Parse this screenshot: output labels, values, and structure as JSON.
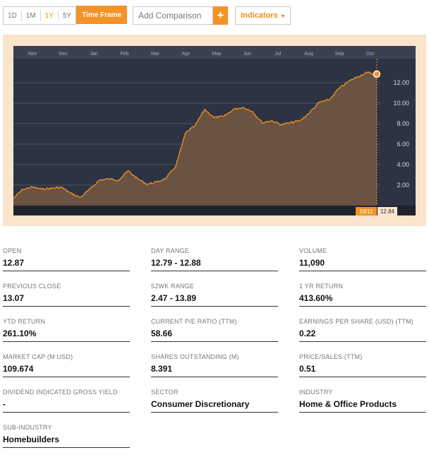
{
  "toolbar": {
    "ranges": [
      "1D",
      "1M",
      "1Y",
      "5Y"
    ],
    "active_range": "1Y",
    "time_frame_label": "Time Frame",
    "compare_placeholder": "Add Comparison",
    "plus_label": "+",
    "indicators_label": "Indicators"
  },
  "chart_data": {
    "type": "area",
    "x_tick_labels": [
      "Nov",
      "Dec",
      "Jan",
      "Feb",
      "Mar",
      "Apr",
      "May",
      "Jun",
      "Jul",
      "Aug",
      "Sep",
      "Oct"
    ],
    "y_ticks": [
      "2.00",
      "4.00",
      "6.00",
      "8.00",
      "10.00",
      "12.00"
    ],
    "ylim": [
      0,
      13.8
    ],
    "x": [
      "10/11",
      "10/21",
      "10/31",
      "11/10",
      "11/20",
      "11/30",
      "12/10",
      "12/20",
      "12/30",
      "01/09",
      "01/19",
      "01/29",
      "02/08",
      "02/18",
      "02/28",
      "03/10",
      "03/20",
      "03/30",
      "04/09",
      "04/19",
      "04/29",
      "05/09",
      "05/19",
      "05/29",
      "06/08",
      "06/18",
      "06/28",
      "07/08",
      "07/18",
      "07/28",
      "08/07",
      "08/17",
      "08/27",
      "09/06",
      "09/16",
      "09/26",
      "10/01",
      "10/06",
      "10/11"
    ],
    "values": [
      0.7,
      1.6,
      1.8,
      1.6,
      1.7,
      1.8,
      1.2,
      0.8,
      1.6,
      2.5,
      2.6,
      2.5,
      3.4,
      2.6,
      2.1,
      2.3,
      2.7,
      3.9,
      7.1,
      7.8,
      9.4,
      8.6,
      8.7,
      9.4,
      9.6,
      9.2,
      8.1,
      8.3,
      7.9,
      8.1,
      8.3,
      9.1,
      10.1,
      10.3,
      11.4,
      12.1,
      12.6,
      13.0,
      12.84
    ],
    "colors": {
      "background": "#2c3342",
      "line": "#f39325",
      "fill": "#6e5542"
    },
    "cursor": {
      "date_label": "10/11",
      "value_label": "12.84"
    }
  },
  "stats": [
    {
      "label": "OPEN",
      "value": "12.87"
    },
    {
      "label": "DAY RANGE",
      "value": "12.79 - 12.88"
    },
    {
      "label": "VOLUME",
      "value": "11,090"
    },
    {
      "label": "PREVIOUS CLOSE",
      "value": "13.07"
    },
    {
      "label": "52WK RANGE",
      "value": "2.47 - 13.89"
    },
    {
      "label": "1 YR RETURN",
      "value": "413.60%"
    },
    {
      "label": "YTD RETURN",
      "value": "261.10%"
    },
    {
      "label": "CURRENT P/E RATIO (TTM)",
      "value": "58.66"
    },
    {
      "label": "EARNINGS PER SHARE (USD) (TTM)",
      "value": "0.22"
    },
    {
      "label": "MARKET CAP (M USD)",
      "value": "109.674"
    },
    {
      "label": "SHARES OUTSTANDING (M)",
      "value": "8.391"
    },
    {
      "label": "PRICE/SALES (TTM)",
      "value": "0.51"
    },
    {
      "label": "DIVIDEND INDICATED GROSS YIELD",
      "value": "-"
    },
    {
      "label": "SECTOR",
      "value": "Consumer Discretionary"
    },
    {
      "label": "INDUSTRY",
      "value": "Home & Office Products"
    },
    {
      "label": "SUB-INDUSTRY",
      "value": "Homebuilders"
    }
  ]
}
